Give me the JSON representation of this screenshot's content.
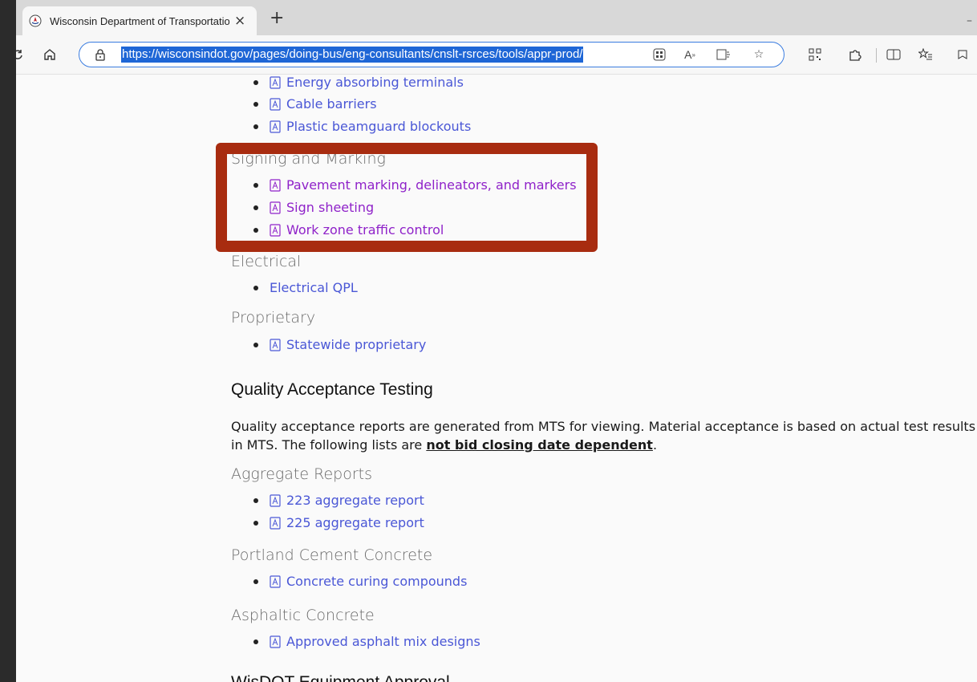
{
  "browser": {
    "tab_title": "Wisconsin Department of Transportation",
    "tab_close": "×",
    "new_tab": "+",
    "url": "https://wisconsindot.gov/pages/doing-bus/eng-consultants/cnslt-rsrces/tools/appr-prod/"
  },
  "sections": {
    "roadside_items": [
      {
        "label": "Energy absorbing terminals"
      },
      {
        "label": "Cable barriers"
      },
      {
        "label": "Plastic beamguard blockouts"
      }
    ],
    "signing": {
      "heading": "Signing and Marking",
      "items": [
        {
          "label": "Pavement marking, delineators, and markers"
        },
        {
          "label": "Sign sheeting"
        },
        {
          "label": "Work zone traffic control"
        }
      ]
    },
    "electrical": {
      "heading": "Electrical",
      "items": [
        {
          "label": "Electrical QPL"
        }
      ]
    },
    "proprietary": {
      "heading": "Proprietary",
      "items": [
        {
          "label": "Statewide proprietary"
        }
      ]
    },
    "quality": {
      "heading": "Quality Acceptance Testing",
      "para_text": "Quality acceptance reports are generated from MTS for viewing. Material acceptance is based on actual test results in MTS. The following lists are ",
      "para_bold": "not bid closing date dependent",
      "para_end": "."
    },
    "aggregate": {
      "heading": "Aggregate Reports",
      "items": [
        {
          "label": "223 aggregate report"
        },
        {
          "label": "225 aggregate report"
        }
      ]
    },
    "pcc": {
      "heading": "Portland Cement Concrete",
      "items": [
        {
          "label": "Concrete curing compounds"
        }
      ]
    },
    "asphalt": {
      "heading": "Asphaltic Concrete",
      "items": [
        {
          "label": "Approved asphalt mix designs"
        }
      ]
    },
    "equipment": {
      "heading": "WisDOT Equipment Approval"
    }
  },
  "colors": {
    "link": "#4a57d6",
    "visited_link": "#8f22c9",
    "highlight_box": "#a82c10",
    "url_selection": "#1e66d6"
  }
}
